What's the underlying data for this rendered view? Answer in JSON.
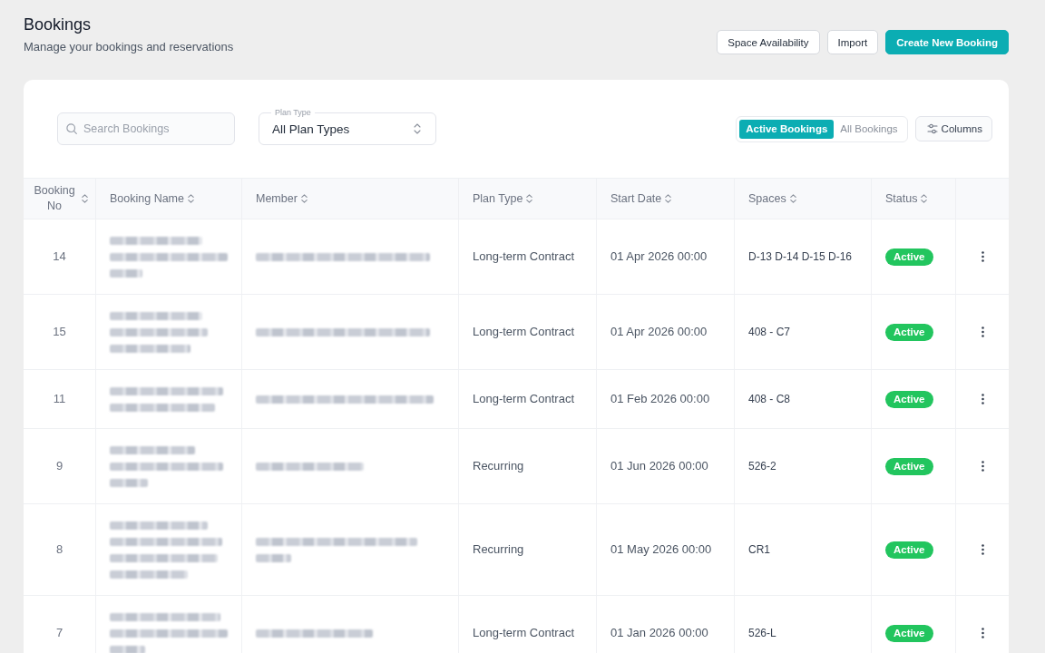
{
  "header": {
    "title": "Bookings",
    "subtitle": "Manage your bookings and reservations",
    "actions": [
      {
        "label": "Space Availability",
        "kind": "secondary"
      },
      {
        "label": "Import",
        "kind": "secondary"
      },
      {
        "label": "Create New Booking",
        "kind": "primary"
      }
    ]
  },
  "toolbar": {
    "search": {
      "placeholder": "Search Bookings"
    },
    "plan_type": {
      "label": "Plan Type",
      "value": "All Plan Types"
    },
    "view_toggle": [
      {
        "label": "Active Bookings",
        "selected": true
      },
      {
        "label": "All Bookings",
        "selected": false
      }
    ],
    "columns_button": "Columns"
  },
  "table": {
    "columns": [
      {
        "label": "Booking No",
        "sortable": true
      },
      {
        "label": "Booking Name",
        "sortable": true
      },
      {
        "label": "Member",
        "sortable": true
      },
      {
        "label": "Plan Type",
        "sortable": true
      },
      {
        "label": "Start Date",
        "sortable": true
      },
      {
        "label": "Spaces",
        "sortable": true
      },
      {
        "label": "Status",
        "sortable": true
      }
    ],
    "rows": [
      {
        "booking_no": "14",
        "plan_type": "Long-term Contract",
        "start_date": "01 Apr 2026 00:00",
        "spaces": "D-13 D-14 D-15 D-16",
        "status": "Active"
      },
      {
        "booking_no": "15",
        "plan_type": "Long-term Contract",
        "start_date": "01 Apr 2026 00:00",
        "spaces": "408 - C7",
        "status": "Active"
      },
      {
        "booking_no": "11",
        "plan_type": "Long-term Contract",
        "start_date": "01 Feb 2026 00:00",
        "spaces": "408 - C8",
        "status": "Active"
      },
      {
        "booking_no": "9",
        "plan_type": "Recurring",
        "start_date": "01 Jun 2026 00:00",
        "spaces": "526-2",
        "status": "Active"
      },
      {
        "booking_no": "8",
        "plan_type": "Recurring",
        "start_date": "01 May 2026 00:00",
        "spaces": "CR1",
        "status": "Active"
      },
      {
        "booking_no": "7",
        "plan_type": "Long-term Contract",
        "start_date": "01 Jan 2026 00:00",
        "spaces": "526-L",
        "status": "Active"
      }
    ]
  }
}
